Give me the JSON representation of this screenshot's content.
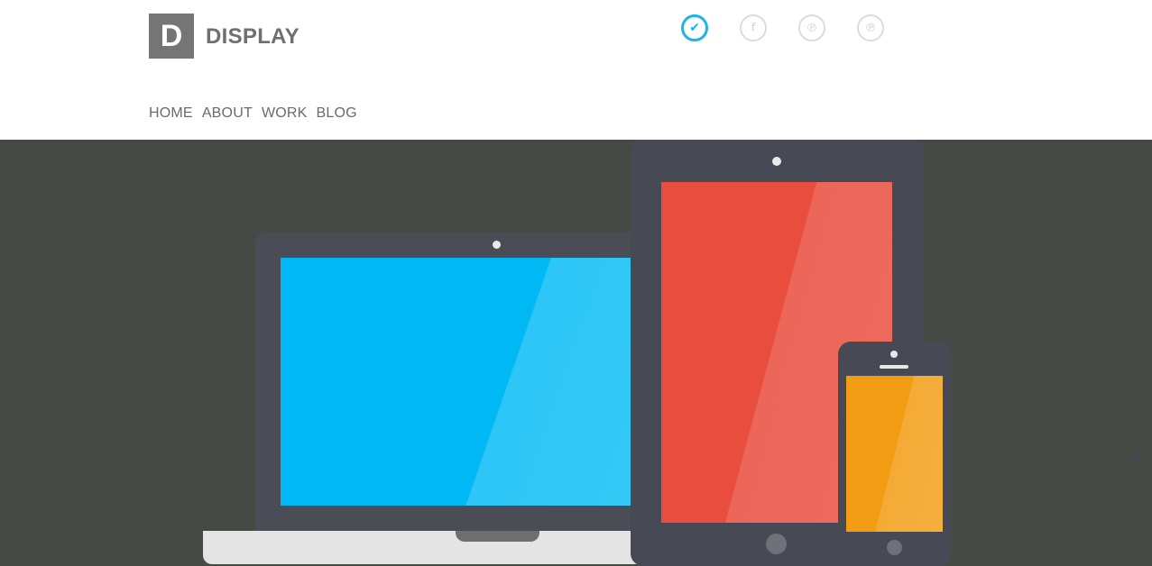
{
  "logo": {
    "letter": "D",
    "name": "DISPLAY"
  },
  "social": [
    {
      "name": "twitter",
      "icon": "twitter-icon",
      "glyph": "✔",
      "active": true
    },
    {
      "name": "facebook",
      "icon": "facebook-icon",
      "glyph": "f",
      "active": false
    },
    {
      "name": "pinterest",
      "icon": "pinterest-icon",
      "glyph": "℗",
      "active": false
    },
    {
      "name": "pinterest",
      "icon": "pinterest-icon",
      "glyph": "℗",
      "active": false
    }
  ],
  "nav": {
    "items": [
      "HOME",
      "ABOUT",
      "WORK",
      "BLOG"
    ]
  },
  "hero": {
    "colors": {
      "background": "#464a44",
      "laptop_screen": "#00b9f4",
      "tablet_screen": "#e84d3d",
      "phone_screen": "#f29c13",
      "device_frame": "#474a54"
    }
  },
  "colors": {
    "accent": "#1eb4e6",
    "logo_bg": "#757575"
  }
}
